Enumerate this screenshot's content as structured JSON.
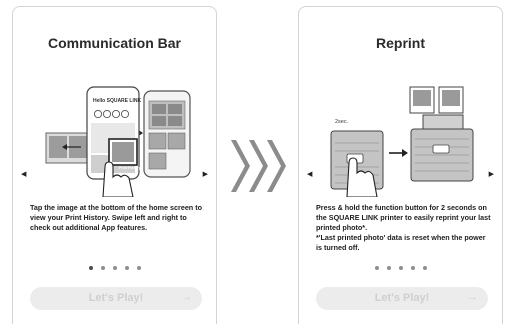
{
  "cards": [
    {
      "title": "Communication Bar",
      "description": [
        "Tap the image at the bottom of the home screen to view your Print History. Swipe left and right to check out additional App features."
      ],
      "play_label": "Let's Play!",
      "phone_text": "Hello SQUARE LINK",
      "tag_text": "Print History",
      "dots": 5,
      "active_dot": 0
    },
    {
      "title": "Reprint",
      "description": [
        "Press & hold the function button for 2 seconds on the SQUARE LINK printer to easily reprint your last printed photo*.",
        "*'Last printed photo' data is reset when the power is turned off."
      ],
      "play_label": "Let's Play!",
      "hold_text": "2sec.",
      "dots": 5,
      "active_dot": 0
    }
  ],
  "icons": {
    "nav_prev": "◀",
    "nav_next": "▶",
    "play_arrow": "→"
  },
  "colors": {
    "button_bg": "#ececec",
    "button_text": "#cfcfcf",
    "chevron": "#8c8c8c"
  }
}
